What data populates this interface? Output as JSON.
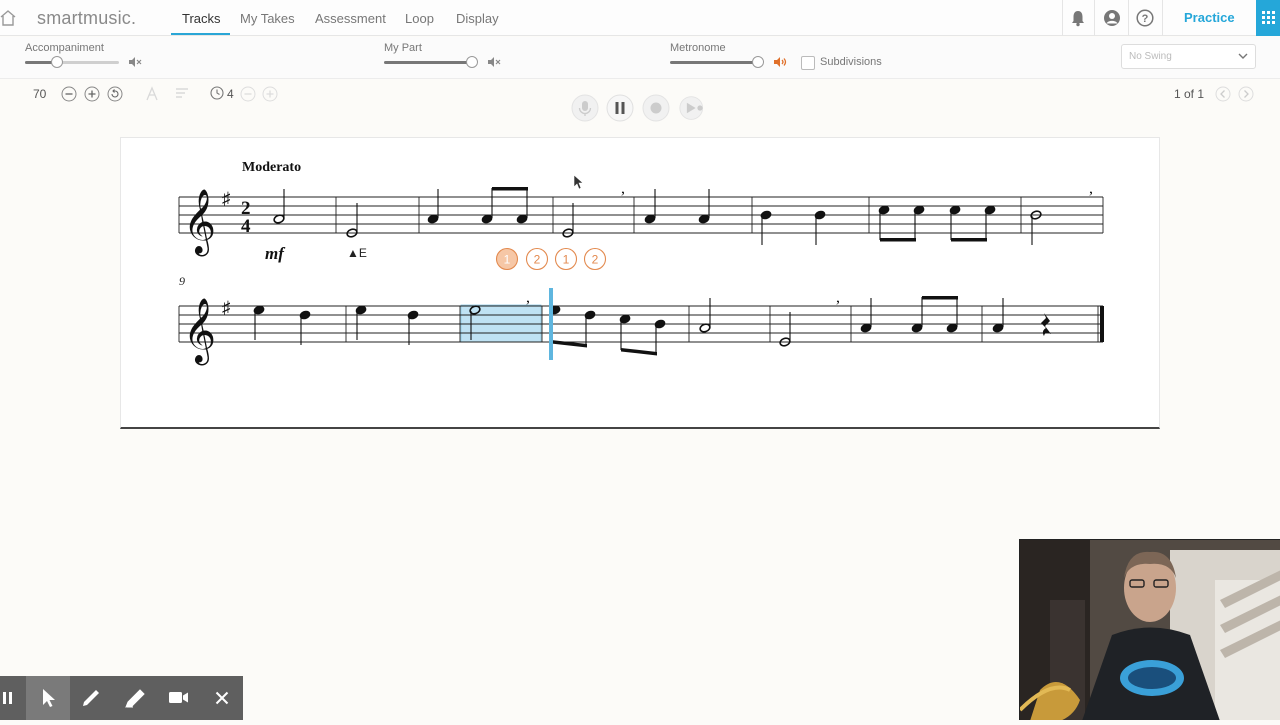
{
  "nav": {
    "brand": "smartmusic.",
    "tabs": [
      {
        "label": "Tracks",
        "active": true
      },
      {
        "label": "My Takes"
      },
      {
        "label": "Assessment"
      },
      {
        "label": "Loop"
      },
      {
        "label": "Display"
      }
    ],
    "practice_label": "Practice"
  },
  "mixer": {
    "accompaniment_label": "Accompaniment",
    "accompaniment_level": 0.33,
    "mypart_label": "My Part",
    "mypart_level": 1.0,
    "metronome_label": "Metronome",
    "metronome_level": 1.0,
    "subdivisions_label": "Subdivisions",
    "subdivisions_checked": false,
    "swing_value": "No Swing"
  },
  "controls": {
    "tempo": "70",
    "count_in": "4",
    "page_indicator": "1 of 1"
  },
  "score": {
    "tempo_marking": "Moderato",
    "dynamic": "mf",
    "fingering_note": "▲E",
    "beat_counters": [
      "1",
      "2",
      "1",
      "2"
    ],
    "active_beat": 0,
    "time_sig_top": "2",
    "time_sig_bottom": "4",
    "measure_number_line2": "9",
    "key_signature": "G major (1 sharp)"
  },
  "colors": {
    "accent": "#25a7d9",
    "metronome_active": "#e0702a",
    "beat_counter": "#e38a4f",
    "loop_highlight": "#bfe2f3"
  },
  "annotation_tools": [
    "pause-icon",
    "pointer-icon",
    "pencil-icon",
    "highlighter-icon",
    "camera-icon",
    "close-icon"
  ]
}
